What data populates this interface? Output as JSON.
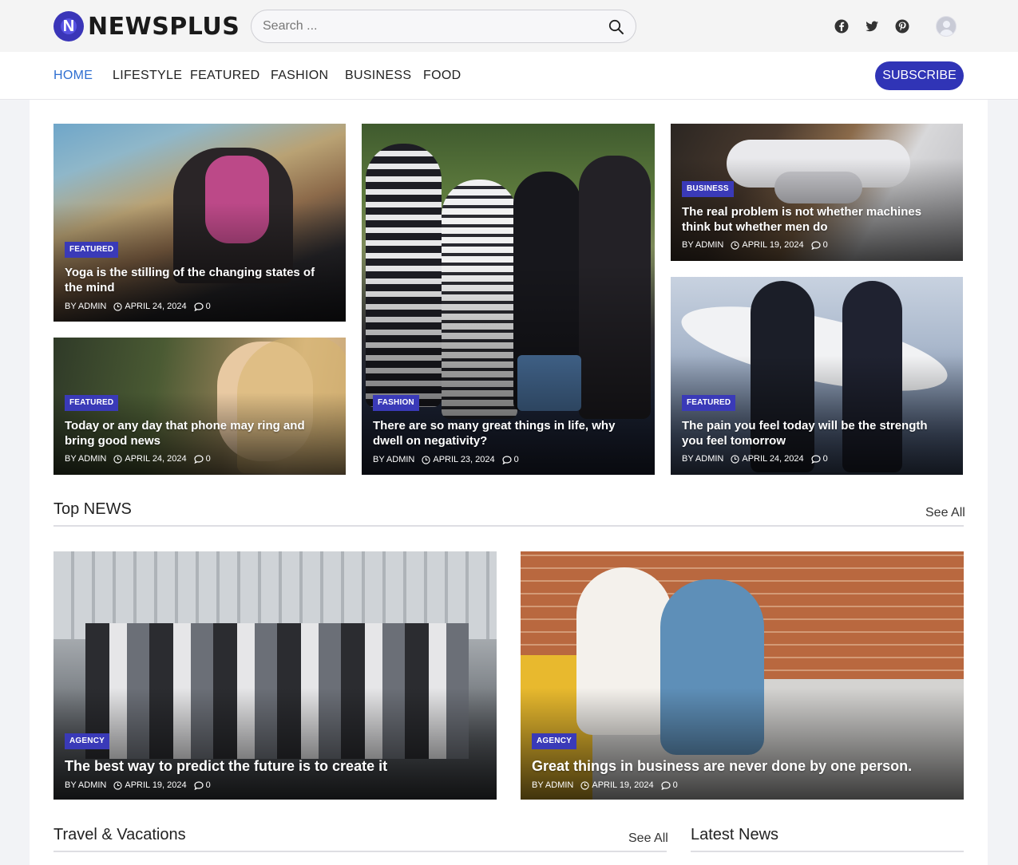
{
  "brand": {
    "name": "NEWSPLUS",
    "mark": "N"
  },
  "search": {
    "placeholder": "Search ..."
  },
  "social": [
    "facebook-icon",
    "twitter-icon",
    "pinterest-icon"
  ],
  "nav": {
    "items": [
      {
        "label": "HOME",
        "active": true
      },
      {
        "label": "LIFESTYLE"
      },
      {
        "label": "FEATURED"
      },
      {
        "label": "FASHION"
      },
      {
        "label": "BUSINESS"
      },
      {
        "label": "FOOD"
      }
    ],
    "subscribe_label": "SUBSCRIBE"
  },
  "hero": [
    {
      "category": "FEATURED",
      "title": "Yoga is the stilling of the changing states of the mind",
      "author": "BY ADMIN",
      "date": "APRIL 24, 2024",
      "comments": "0"
    },
    {
      "category": "FEATURED",
      "title": "Today or any day that phone may ring and bring good news",
      "author": "BY ADMIN",
      "date": "APRIL 24, 2024",
      "comments": "0"
    },
    {
      "category": "FASHION",
      "title": "There are so many great things in life, why dwell on negativity?",
      "author": "BY ADMIN",
      "date": "APRIL 23, 2024",
      "comments": "0"
    },
    {
      "category": "BUSINESS",
      "title": "The real problem is not whether machines think but whether men do",
      "author": "BY ADMIN",
      "date": "APRIL 19, 2024",
      "comments": "0"
    },
    {
      "category": "FEATURED",
      "title": "The pain you feel today will be the strength you feel tomorrow",
      "author": "BY ADMIN",
      "date": "APRIL 24, 2024",
      "comments": "0"
    }
  ],
  "top_news": {
    "title": "Top NEWS",
    "see_all": "See All",
    "items": [
      {
        "category": "AGENCY",
        "title": "The best way to predict the future is to create it",
        "author": "BY ADMIN",
        "date": "APRIL 19, 2024",
        "comments": "0"
      },
      {
        "category": "AGENCY",
        "title": "Great things in business are never done by one person.",
        "author": "BY ADMIN",
        "date": "APRIL 19, 2024",
        "comments": "0"
      }
    ]
  },
  "travel": {
    "title": "Travel & Vacations",
    "see_all": "See All"
  },
  "latest": {
    "title": "Latest News"
  },
  "colors": {
    "accent": "#3034b6",
    "badge": "#3a3ab8",
    "nav_active": "#2f6fd1"
  }
}
